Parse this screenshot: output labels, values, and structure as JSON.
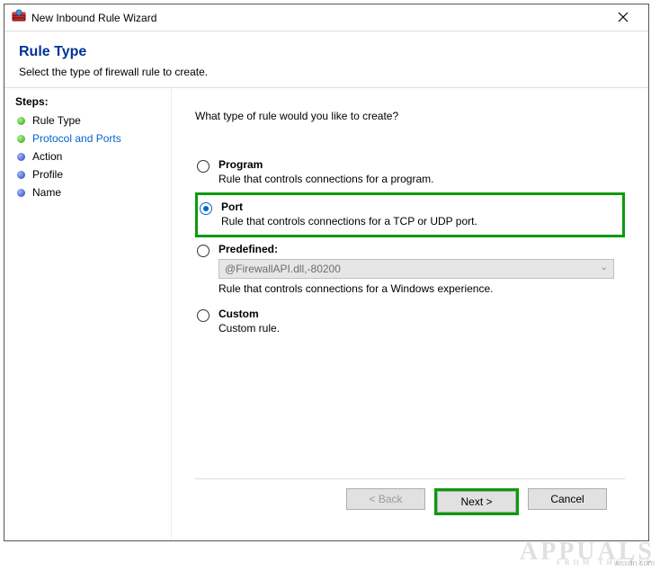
{
  "window": {
    "title": "New Inbound Rule Wizard"
  },
  "header": {
    "title": "Rule Type",
    "subtitle": "Select the type of firewall rule to create."
  },
  "sidebar": {
    "heading": "Steps:",
    "items": [
      {
        "label": "Rule Type",
        "bullet": "green",
        "active": false
      },
      {
        "label": "Protocol and Ports",
        "bullet": "green",
        "active": true
      },
      {
        "label": "Action",
        "bullet": "blue",
        "active": false
      },
      {
        "label": "Profile",
        "bullet": "blue",
        "active": false
      },
      {
        "label": "Name",
        "bullet": "blue",
        "active": false
      }
    ]
  },
  "main": {
    "prompt": "What type of rule would you like to create?",
    "options": {
      "program": {
        "label": "Program",
        "desc": "Rule that controls connections for a program."
      },
      "port": {
        "label": "Port",
        "desc": "Rule that controls connections for a TCP or UDP port."
      },
      "predefined": {
        "label": "Predefined:",
        "selectValue": "@FirewallAPI.dll,-80200",
        "desc": "Rule that controls connections for a Windows experience."
      },
      "custom": {
        "label": "Custom",
        "desc": "Custom rule."
      }
    }
  },
  "footer": {
    "back": "< Back",
    "next": "Next >",
    "cancel": "Cancel"
  },
  "watermark": {
    "brand": "APPUALS",
    "tag": "FROM   THE   EXP"
  },
  "source": "wsxdn.com"
}
